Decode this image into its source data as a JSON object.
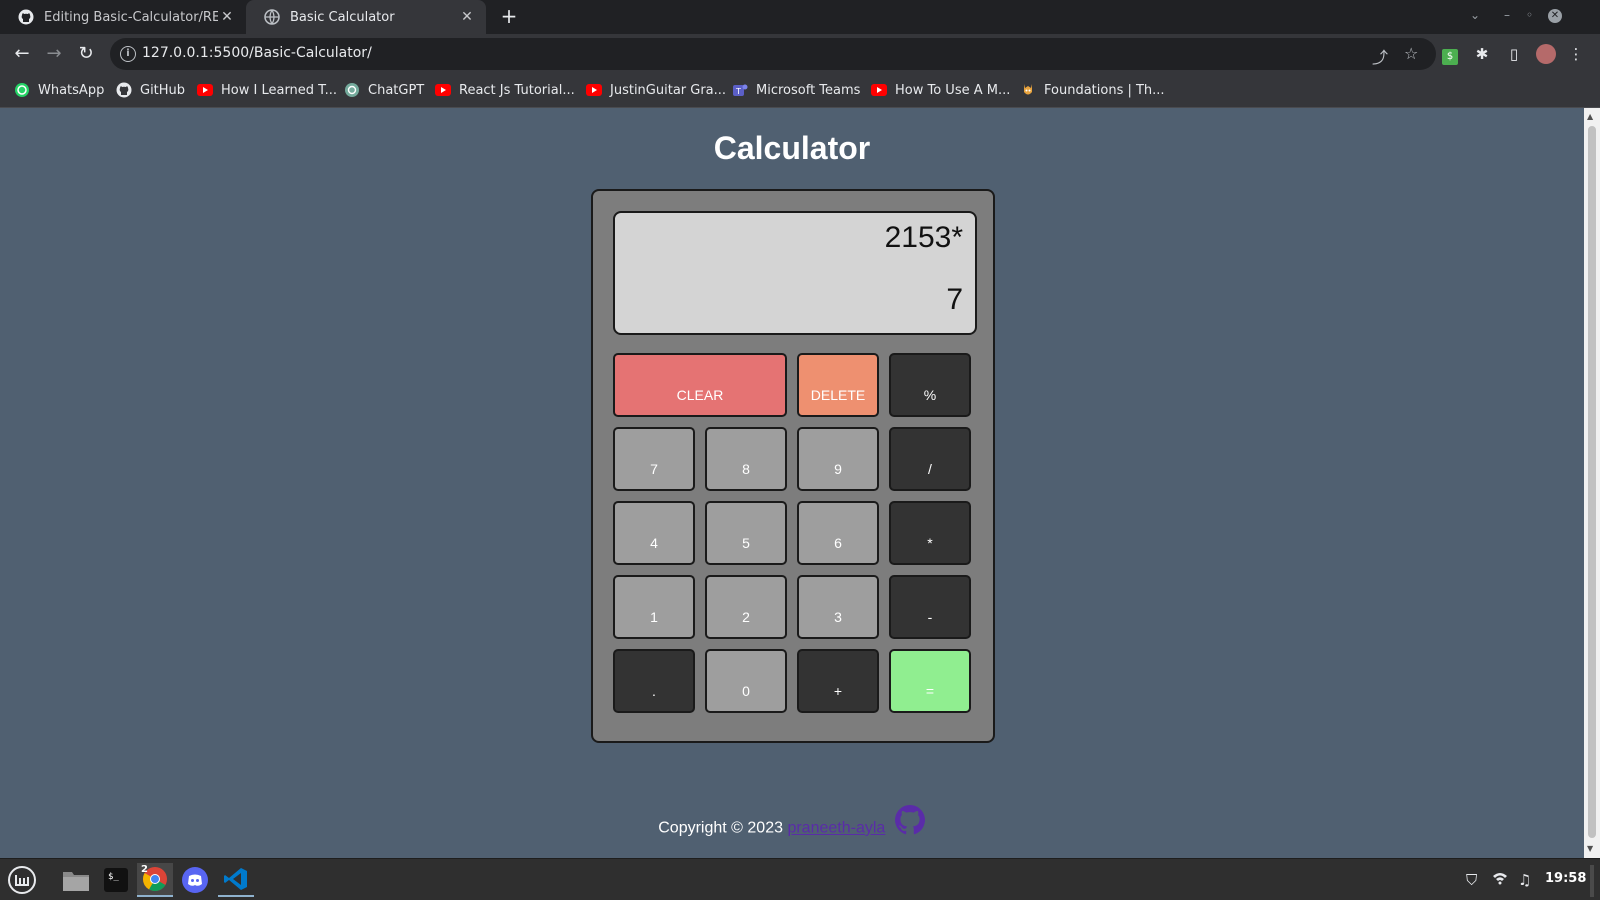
{
  "browser": {
    "tabs": [
      {
        "title": "Editing Basic-Calculator/README",
        "favicon": "github-icon",
        "active": false
      },
      {
        "title": "Basic Calculator",
        "favicon": "globe-icon",
        "active": true
      }
    ],
    "url": "127.0.0.1:5500/Basic-Calculator/",
    "bookmarks": [
      {
        "label": "WhatsApp",
        "icon": "whatsapp-icon"
      },
      {
        "label": "GitHub",
        "icon": "github-icon"
      },
      {
        "label": "How I Learned T...",
        "icon": "youtube-icon"
      },
      {
        "label": "ChatGPT",
        "icon": "chatgpt-icon"
      },
      {
        "label": "React Js Tutorial...",
        "icon": "youtube-icon"
      },
      {
        "label": "JustinGuitar Gra...",
        "icon": "youtube-icon"
      },
      {
        "label": "Microsoft Teams",
        "icon": "teams-icon"
      },
      {
        "label": "How To Use A M...",
        "icon": "youtube-icon"
      },
      {
        "label": "Foundations | Th...",
        "icon": "odin-icon"
      }
    ]
  },
  "app": {
    "title": "Calculator",
    "display": {
      "previous": "2153*",
      "current": "7"
    },
    "keys": {
      "clear": "CLEAR",
      "delete": "DELETE",
      "percent": "%",
      "seven": "7",
      "eight": "8",
      "nine": "9",
      "divide": "/",
      "four": "4",
      "five": "5",
      "six": "6",
      "multiply": "*",
      "one": "1",
      "two": "2",
      "three": "3",
      "subtract": "-",
      "decimal": ".",
      "zero": "0",
      "add": "+",
      "equals": "="
    },
    "footer": {
      "copyright": "Copyright © 2023",
      "author": "praneeth-ayla"
    }
  },
  "taskbar": {
    "chrome_badge": "2",
    "clock": "19:58"
  },
  "colors": {
    "page_bg": "#506071",
    "calc_body": "#7d7d7d",
    "clear_key": "#e57373",
    "delete_key": "#ee9070",
    "equals_key": "#90ee90",
    "number_key": "#9e9e9e",
    "operator_key": "#333333"
  }
}
